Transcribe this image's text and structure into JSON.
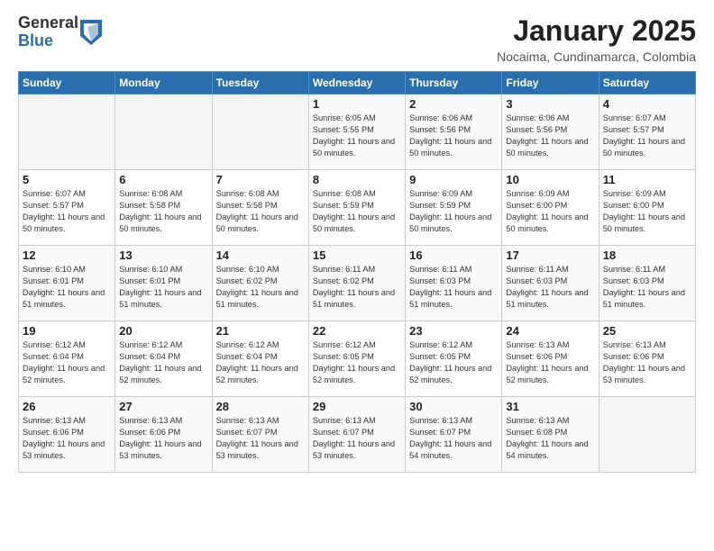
{
  "header": {
    "logo_general": "General",
    "logo_blue": "Blue",
    "title": "January 2025",
    "location": "Nocaima, Cundinamarca, Colombia"
  },
  "calendar": {
    "days_of_week": [
      "Sunday",
      "Monday",
      "Tuesday",
      "Wednesday",
      "Thursday",
      "Friday",
      "Saturday"
    ],
    "weeks": [
      [
        {
          "day": "",
          "info": ""
        },
        {
          "day": "",
          "info": ""
        },
        {
          "day": "",
          "info": ""
        },
        {
          "day": "1",
          "info": "Sunrise: 6:05 AM\nSunset: 5:55 PM\nDaylight: 11 hours\nand 50 minutes."
        },
        {
          "day": "2",
          "info": "Sunrise: 6:06 AM\nSunset: 5:56 PM\nDaylight: 11 hours\nand 50 minutes."
        },
        {
          "day": "3",
          "info": "Sunrise: 6:06 AM\nSunset: 5:56 PM\nDaylight: 11 hours\nand 50 minutes."
        },
        {
          "day": "4",
          "info": "Sunrise: 6:07 AM\nSunset: 5:57 PM\nDaylight: 11 hours\nand 50 minutes."
        }
      ],
      [
        {
          "day": "5",
          "info": "Sunrise: 6:07 AM\nSunset: 5:57 PM\nDaylight: 11 hours\nand 50 minutes."
        },
        {
          "day": "6",
          "info": "Sunrise: 6:08 AM\nSunset: 5:58 PM\nDaylight: 11 hours\nand 50 minutes."
        },
        {
          "day": "7",
          "info": "Sunrise: 6:08 AM\nSunset: 5:58 PM\nDaylight: 11 hours\nand 50 minutes."
        },
        {
          "day": "8",
          "info": "Sunrise: 6:08 AM\nSunset: 5:59 PM\nDaylight: 11 hours\nand 50 minutes."
        },
        {
          "day": "9",
          "info": "Sunrise: 6:09 AM\nSunset: 5:59 PM\nDaylight: 11 hours\nand 50 minutes."
        },
        {
          "day": "10",
          "info": "Sunrise: 6:09 AM\nSunset: 6:00 PM\nDaylight: 11 hours\nand 50 minutes."
        },
        {
          "day": "11",
          "info": "Sunrise: 6:09 AM\nSunset: 6:00 PM\nDaylight: 11 hours\nand 50 minutes."
        }
      ],
      [
        {
          "day": "12",
          "info": "Sunrise: 6:10 AM\nSunset: 6:01 PM\nDaylight: 11 hours\nand 51 minutes."
        },
        {
          "day": "13",
          "info": "Sunrise: 6:10 AM\nSunset: 6:01 PM\nDaylight: 11 hours\nand 51 minutes."
        },
        {
          "day": "14",
          "info": "Sunrise: 6:10 AM\nSunset: 6:02 PM\nDaylight: 11 hours\nand 51 minutes."
        },
        {
          "day": "15",
          "info": "Sunrise: 6:11 AM\nSunset: 6:02 PM\nDaylight: 11 hours\nand 51 minutes."
        },
        {
          "day": "16",
          "info": "Sunrise: 6:11 AM\nSunset: 6:03 PM\nDaylight: 11 hours\nand 51 minutes."
        },
        {
          "day": "17",
          "info": "Sunrise: 6:11 AM\nSunset: 6:03 PM\nDaylight: 11 hours\nand 51 minutes."
        },
        {
          "day": "18",
          "info": "Sunrise: 6:11 AM\nSunset: 6:03 PM\nDaylight: 11 hours\nand 51 minutes."
        }
      ],
      [
        {
          "day": "19",
          "info": "Sunrise: 6:12 AM\nSunset: 6:04 PM\nDaylight: 11 hours\nand 52 minutes."
        },
        {
          "day": "20",
          "info": "Sunrise: 6:12 AM\nSunset: 6:04 PM\nDaylight: 11 hours\nand 52 minutes."
        },
        {
          "day": "21",
          "info": "Sunrise: 6:12 AM\nSunset: 6:04 PM\nDaylight: 11 hours\nand 52 minutes."
        },
        {
          "day": "22",
          "info": "Sunrise: 6:12 AM\nSunset: 6:05 PM\nDaylight: 11 hours\nand 52 minutes."
        },
        {
          "day": "23",
          "info": "Sunrise: 6:12 AM\nSunset: 6:05 PM\nDaylight: 11 hours\nand 52 minutes."
        },
        {
          "day": "24",
          "info": "Sunrise: 6:13 AM\nSunset: 6:06 PM\nDaylight: 11 hours\nand 52 minutes."
        },
        {
          "day": "25",
          "info": "Sunrise: 6:13 AM\nSunset: 6:06 PM\nDaylight: 11 hours\nand 53 minutes."
        }
      ],
      [
        {
          "day": "26",
          "info": "Sunrise: 6:13 AM\nSunset: 6:06 PM\nDaylight: 11 hours\nand 53 minutes."
        },
        {
          "day": "27",
          "info": "Sunrise: 6:13 AM\nSunset: 6:06 PM\nDaylight: 11 hours\nand 53 minutes."
        },
        {
          "day": "28",
          "info": "Sunrise: 6:13 AM\nSunset: 6:07 PM\nDaylight: 11 hours\nand 53 minutes."
        },
        {
          "day": "29",
          "info": "Sunrise: 6:13 AM\nSunset: 6:07 PM\nDaylight: 11 hours\nand 53 minutes."
        },
        {
          "day": "30",
          "info": "Sunrise: 6:13 AM\nSunset: 6:07 PM\nDaylight: 11 hours\nand 54 minutes."
        },
        {
          "day": "31",
          "info": "Sunrise: 6:13 AM\nSunset: 6:08 PM\nDaylight: 11 hours\nand 54 minutes."
        },
        {
          "day": "",
          "info": ""
        }
      ]
    ]
  }
}
